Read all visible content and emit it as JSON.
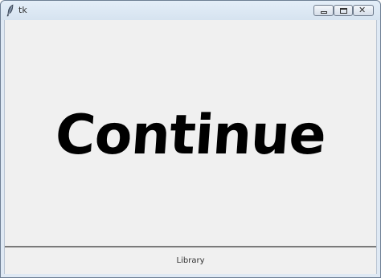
{
  "window": {
    "title": "tk",
    "app_icon": "feather-icon",
    "controls": {
      "minimize_icon": "minimize-icon",
      "maximize_icon": "maximize-icon",
      "close_icon": "close-icon",
      "close_glyph": "✕"
    }
  },
  "main": {
    "continue_label": "Continue"
  },
  "bottom": {
    "library_label": "Library"
  },
  "colors": {
    "background": "#f0f0f0",
    "text": "#000000",
    "title_bar": "#dfe9f4"
  }
}
